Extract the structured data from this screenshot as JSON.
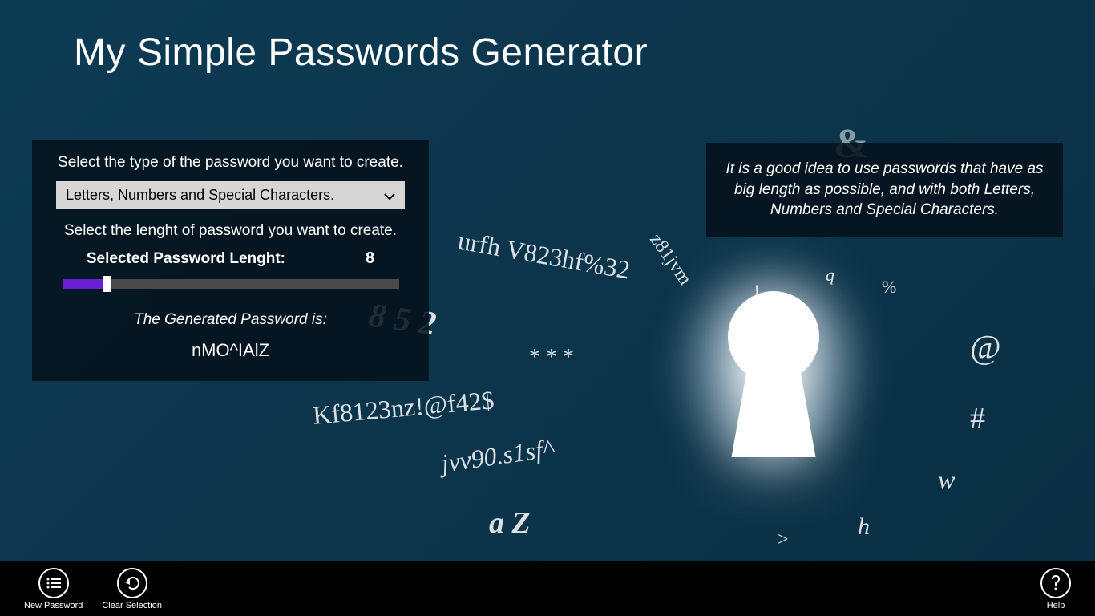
{
  "title": "My Simple Passwords Generator",
  "panel": {
    "type_label": "Select the type of the password you want to create.",
    "dropdown_value": "Letters, Numbers and Special Characters.",
    "length_label": "Select the lenght of password you want to create.",
    "selected_length_label": "Selected Password Lenght:",
    "selected_length_value": "8",
    "generated_label": "The Generated Password is:",
    "generated_password": "nMO^IAlZ"
  },
  "tip": "It is a good idea to use passwords that have as big length as possible, and with both Letters, Numbers and Special Characters.",
  "appbar": {
    "new_password": "New Password",
    "clear_selection": "Clear Selection",
    "help": "Help"
  },
  "decorative_text": {
    "t1": "urfh V823hf%32",
    "t2": "z81jvm",
    "t3": "8 5 2",
    "t4": "* * *",
    "t5": "Kf8123nz!@f42$",
    "t6": "jvv90.s1sf^",
    "t7": "a Z",
    "t8": "@",
    "t9": "#",
    "t10": "%",
    "t11": "!",
    "t12": "q",
    "t13": "&",
    "t14": "w",
    "t15": "h",
    "t16": ">"
  }
}
